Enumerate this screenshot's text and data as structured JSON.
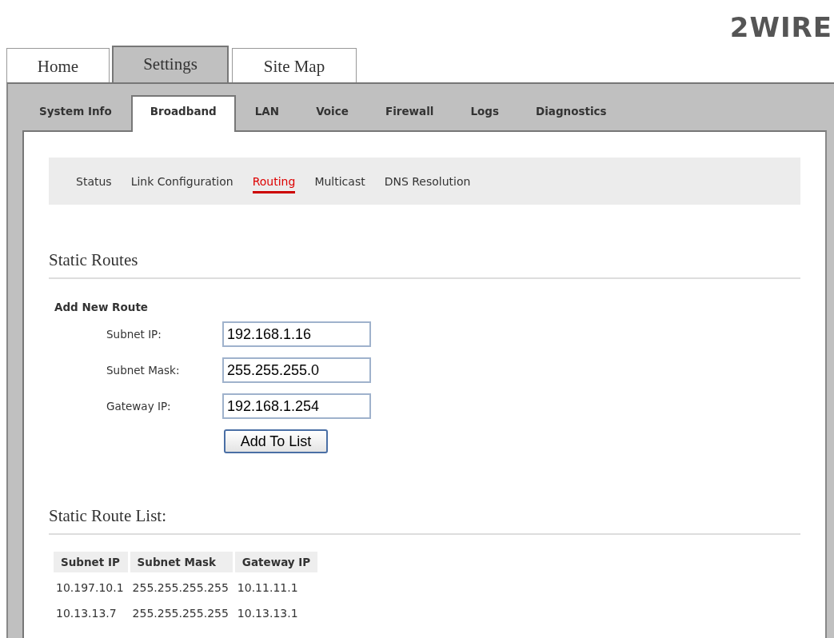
{
  "logo": "2WIRE",
  "tabs": [
    {
      "label": "Home",
      "selected": false
    },
    {
      "label": "Settings",
      "selected": true
    },
    {
      "label": "Site Map",
      "selected": false
    }
  ],
  "subtabs": [
    {
      "label": "System Info",
      "selected": false
    },
    {
      "label": "Broadband",
      "selected": true
    },
    {
      "label": "LAN",
      "selected": false
    },
    {
      "label": "Voice",
      "selected": false
    },
    {
      "label": "Firewall",
      "selected": false
    },
    {
      "label": "Logs",
      "selected": false
    },
    {
      "label": "Diagnostics",
      "selected": false
    }
  ],
  "subnav": [
    {
      "label": "Status",
      "selected": false
    },
    {
      "label": "Link Configuration",
      "selected": false
    },
    {
      "label": "Routing",
      "selected": true
    },
    {
      "label": "Multicast",
      "selected": false
    },
    {
      "label": "DNS Resolution",
      "selected": false
    }
  ],
  "static_routes": {
    "title": "Static Routes",
    "form_title": "Add New Route",
    "fields": [
      {
        "label": "Subnet IP:",
        "value": "192.168.1.16"
      },
      {
        "label": "Subnet Mask:",
        "value": "255.255.255.0"
      },
      {
        "label": "Gateway IP:",
        "value": "192.168.1.254"
      }
    ],
    "button": "Add To List"
  },
  "route_list": {
    "title": "Static Route List:",
    "columns": [
      "Subnet IP",
      "Subnet Mask",
      "Gateway IP"
    ],
    "rows": [
      [
        "10.197.10.1",
        "255.255.255.255",
        "10.11.11.1"
      ],
      [
        "10.13.13.7",
        "255.255.255.255",
        "10.13.13.1"
      ]
    ]
  }
}
